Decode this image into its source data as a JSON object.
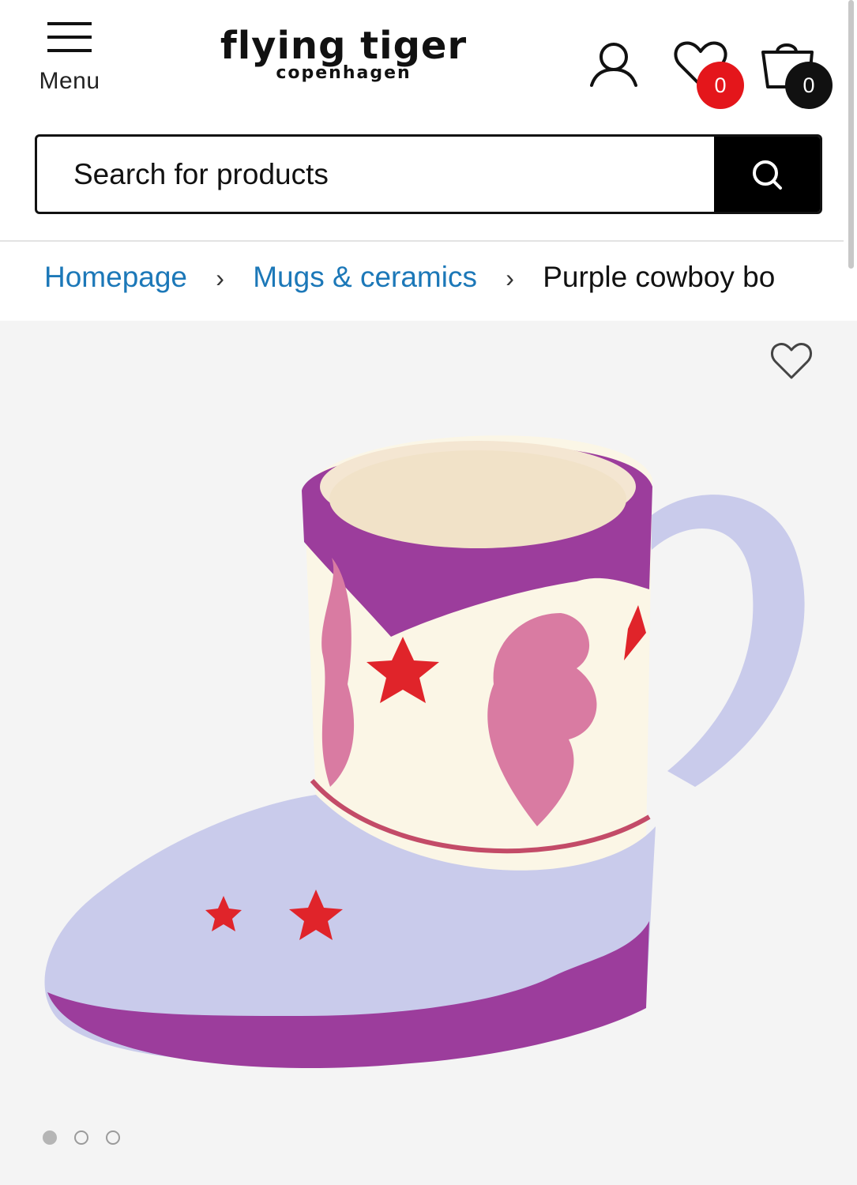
{
  "header": {
    "menu_label": "Menu",
    "logo_line1": "flying tiger",
    "logo_line2": "copenhagen",
    "wishlist_count": "0",
    "cart_count": "0",
    "wishlist_badge_color": "#e4161b",
    "cart_badge_color": "#111111"
  },
  "search": {
    "placeholder": "Search for products"
  },
  "breadcrumb": {
    "items": [
      "Homepage",
      "Mugs & ceramics"
    ],
    "current": "Purple cowboy bo"
  },
  "gallery": {
    "image_label": "Purple cowboy boot mug",
    "slide_count": 3,
    "active_slide": 1
  },
  "icons": [
    "hamburger-icon",
    "user-icon",
    "heart-icon",
    "shopping-bag-icon",
    "search-icon",
    "chevron-right-icon",
    "heart-outline-icon"
  ]
}
